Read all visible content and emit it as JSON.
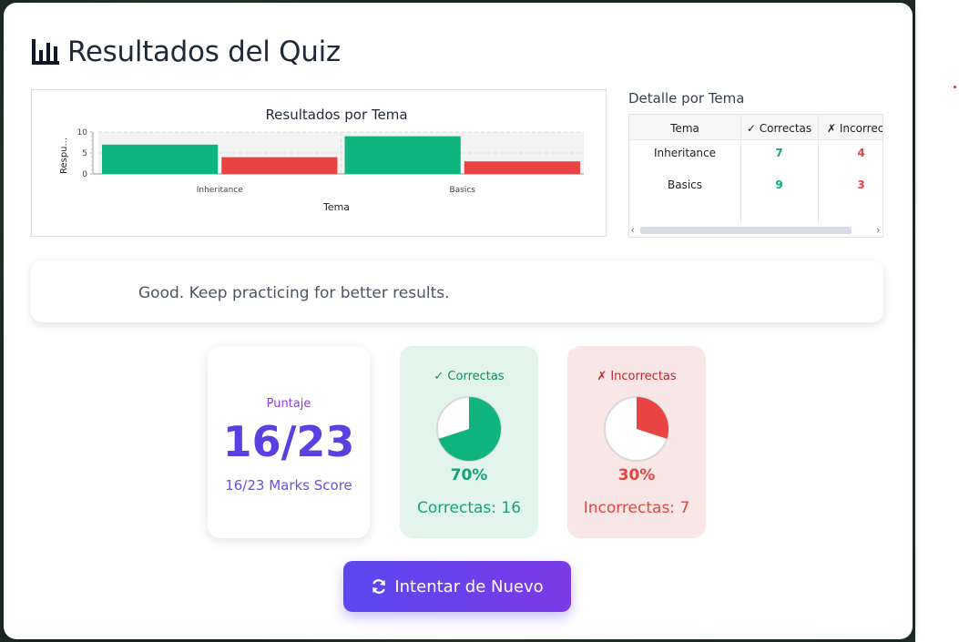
{
  "page": {
    "title": "Resultados del Quiz",
    "icon": "bar-chart-icon"
  },
  "chart_data": {
    "type": "bar",
    "title": "Resultados por Tema",
    "xlabel": "Tema",
    "ylabel": "Respu...",
    "categories": [
      "Inheritance",
      "Basics"
    ],
    "series": [
      {
        "name": "Correctas",
        "values": [
          7,
          9
        ],
        "color": "#10b47e"
      },
      {
        "name": "Incorrectas",
        "values": [
          4,
          3
        ],
        "color": "#ea4343"
      }
    ],
    "ylim": [
      0,
      10
    ],
    "yticks": [
      "10",
      "5",
      "0"
    ],
    "grid": true
  },
  "detail": {
    "title": "Detalle por Tema",
    "headers": [
      "Tema",
      "✓ Correctas",
      "✗ Incorrectas"
    ],
    "rows": [
      {
        "tema": "Inheritance",
        "correctas": "7",
        "incorrectas": "4"
      },
      {
        "tema": "Basics",
        "correctas": "9",
        "incorrectas": "3"
      }
    ]
  },
  "feedback": {
    "message": "Good. Keep practicing for better results."
  },
  "score": {
    "label": "Puntaje",
    "value": "16/23",
    "subtitle": "16/23 Marks Score"
  },
  "correct": {
    "title": "✓ Correctas",
    "fraction": 0.7,
    "percent": "70%",
    "count_label": "Correctas: 16",
    "color": "#10b47e"
  },
  "incorrect": {
    "title": "✗ Incorrectas",
    "fraction": 0.3,
    "percent": "30%",
    "count_label": "Incorrectas: 7",
    "color": "#ea4343"
  },
  "actions": {
    "retry_label": "Intentar de Nuevo",
    "retry_icon": "refresh-icon"
  }
}
